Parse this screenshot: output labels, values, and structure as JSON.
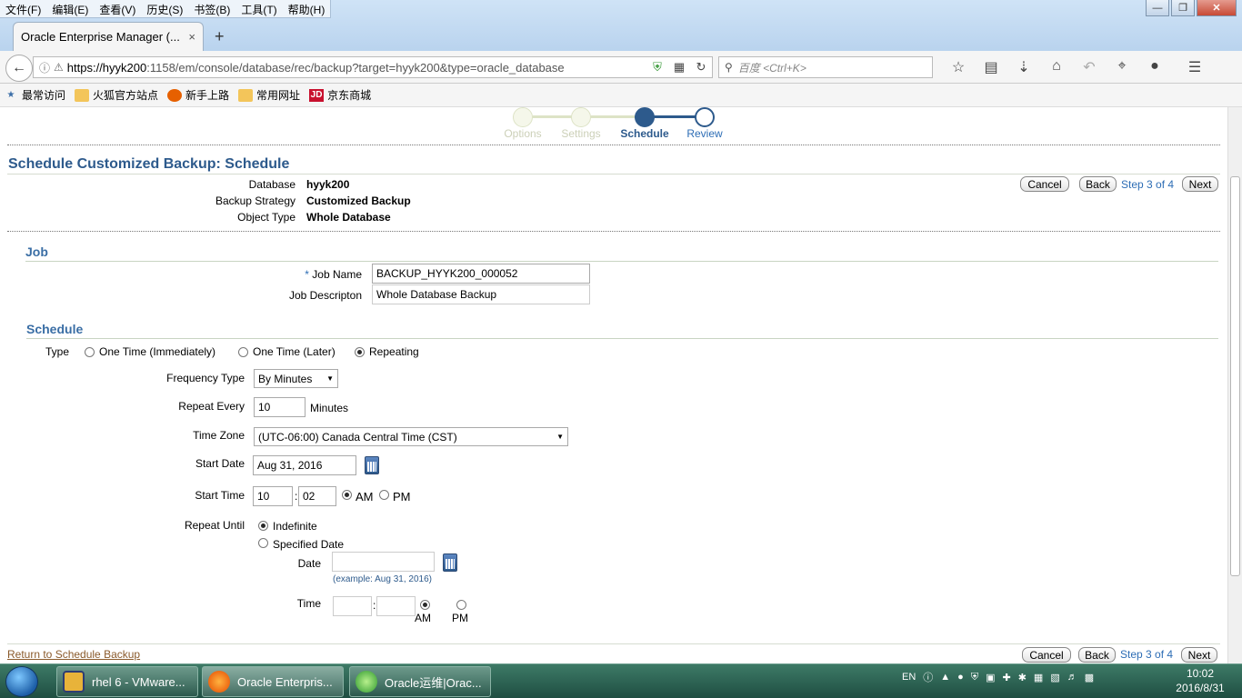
{
  "browser": {
    "menu": [
      "文件(F)",
      "编辑(E)",
      "查看(V)",
      "历史(S)",
      "书签(B)",
      "工具(T)",
      "帮助(H)"
    ],
    "tab_title": "Oracle Enterprise Manager (...",
    "tab_close": "×",
    "new_tab": "+",
    "url_host": "https://hyyk200",
    "url_rest": ":1158/em/console/database/rec/backup?target=hyyk200&type=oracle_database",
    "search_placeholder": "百度 <Ctrl+K>",
    "bookmarks": [
      "最常访问",
      "火狐官方站点",
      "新手上路",
      "常用网址",
      "京东商城"
    ]
  },
  "train": {
    "steps": [
      "Options",
      "Settings",
      "Schedule",
      "Review"
    ],
    "current_index": 2
  },
  "page": {
    "title": "Schedule Customized Backup: Schedule",
    "info": [
      {
        "label": "Database",
        "value": "hyyk200"
      },
      {
        "label": "Backup Strategy",
        "value": "Customized Backup"
      },
      {
        "label": "Object Type",
        "value": "Whole Database"
      }
    ],
    "buttons": {
      "cancel": "Cancel",
      "back": "Back",
      "next": "Next",
      "step_text": "Step 3 of 4"
    }
  },
  "job": {
    "section_title": "Job",
    "name_label": "Job Name",
    "required_mark": "*",
    "name_value": "BACKUP_HYYK200_000052",
    "desc_label": "Job Descripton",
    "desc_value": "Whole Database Backup"
  },
  "schedule": {
    "section_title": "Schedule",
    "type_label": "Type",
    "type_options": [
      "One Time (Immediately)",
      "One Time (Later)",
      "Repeating"
    ],
    "type_selected": "Repeating",
    "freq_label": "Frequency Type",
    "freq_value": "By Minutes",
    "repeat_label": "Repeat Every",
    "repeat_value": "10",
    "repeat_unit": "Minutes",
    "tz_label": "Time Zone",
    "tz_value": "(UTC-06:00) Canada Central Time (CST)",
    "start_date_label": "Start Date",
    "start_date_value": "Aug 31, 2016",
    "start_time_label": "Start Time",
    "start_hour": "10",
    "start_min": "02",
    "colon": ":",
    "am": "AM",
    "pm": "PM",
    "start_ampm": "AM",
    "until_label": "Repeat Until",
    "until_options": [
      "Indefinite",
      "Specified Date"
    ],
    "until_selected": "Indefinite",
    "date_label": "Date",
    "date_value": "",
    "date_hint": "(example: Aug 31, 2016)",
    "time_label": "Time",
    "until_ampm": "AM"
  },
  "footer": {
    "return_link": "Return to Schedule Backup"
  },
  "taskbar": {
    "items": [
      "rhel 6 - VMware...",
      "Oracle Enterpris...",
      "Oracle运维|Orac..."
    ],
    "lang": "EN",
    "time": "10:02",
    "date": "2016/8/31"
  }
}
